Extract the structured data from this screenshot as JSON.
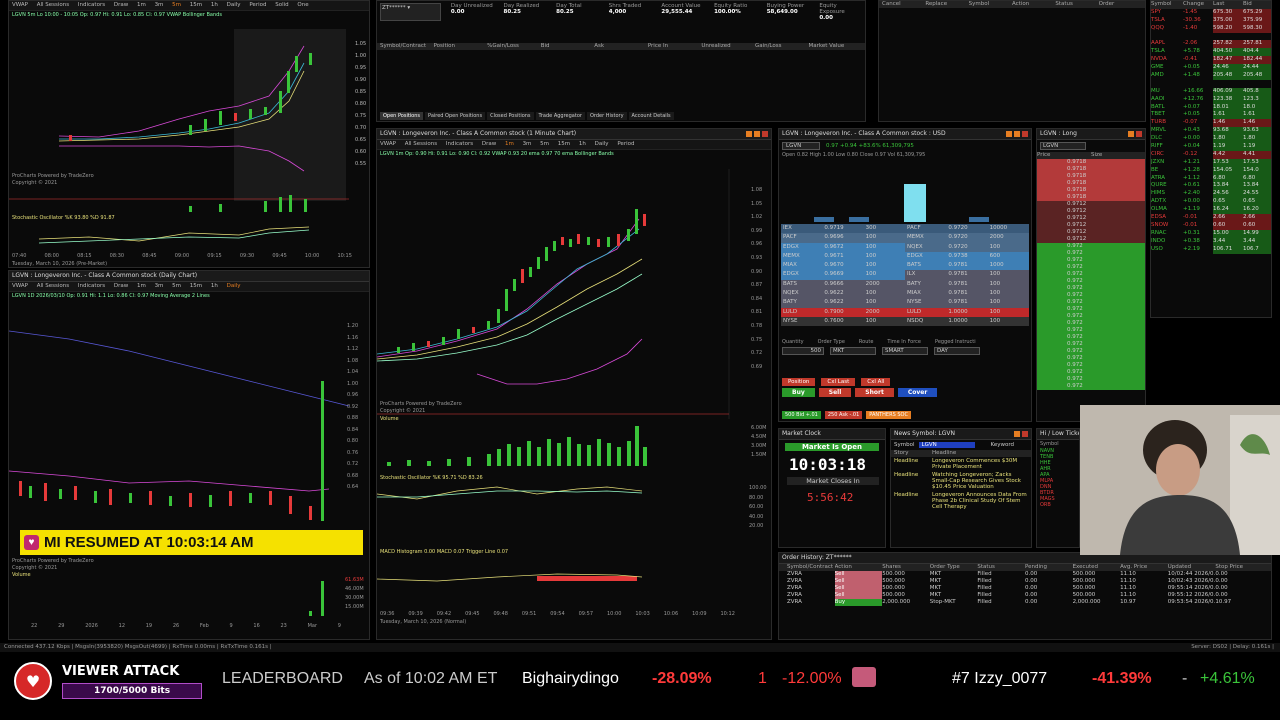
{
  "top_left_chart": {
    "toolbar": [
      "VWAP",
      "All Sessions",
      "Indicators",
      "Draw",
      "1m",
      "3m",
      "5m",
      "15m",
      "1h",
      "Daily",
      "Period",
      "Solid",
      "One"
    ],
    "info": "LGVN 5m  Lo 10:00 - 10:05  Op: 0.97  Hi: 0.91  Lo: 0.85  Cl: 0.97  VWAP  Bollinger Bands",
    "bottom_label": "ProCharts Powered by TradeZero",
    "copyright": "Copyright © 2021",
    "date_label": "Tuesday, March 10, 2026 (Pre-Market)",
    "stoch_label": "Stochastic Oscillator  %K 93.80  %D 91.87",
    "x_ticks": [
      "07:40",
      "08:00",
      "08:15",
      "08:30",
      "08:45",
      "09:00",
      "09:15",
      "09:30",
      "09:45",
      "10:00",
      "10:15"
    ],
    "y_ticks": [
      "1.05",
      "1.00",
      "0.95",
      "0.90",
      "0.85",
      "0.80",
      "0.75",
      "0.70",
      "0.65",
      "0.60",
      "0.55"
    ]
  },
  "daily_chart": {
    "title": "LGVN : Longeveron Inc. - Class A Common stock (Daily Chart)",
    "info": "LGVN 1D  2026/03/10  Op: 0.91  Hi: 1.1  Lo: 0.86  Cl: 0.97  Moving Average 2 Lines",
    "x_ticks": [
      "22",
      "29",
      "2026",
      "12",
      "19",
      "26",
      "Feb",
      "9",
      "16",
      "23",
      "Mar",
      "9"
    ],
    "y_ticks": [
      "1.20",
      "1.16",
      "1.12",
      "1.08",
      "1.04",
      "1.00",
      "0.96",
      "0.92",
      "0.88",
      "0.84",
      "0.80",
      "0.76",
      "0.72",
      "0.68",
      "0.64"
    ],
    "volume_label": "Volume",
    "vol_ticks": [
      "61.63M",
      "46.00M",
      "30.00M",
      "15.00M"
    ]
  },
  "resumed_banner": "MI RESUMED AT 10:03:14 AM",
  "account": {
    "account_id": "ZT******",
    "stats": [
      {
        "label": "Day Unrealized",
        "value": "0.00"
      },
      {
        "label": "Day Realized",
        "value": "80.25"
      },
      {
        "label": "Day Total",
        "value": "80.25"
      },
      {
        "label": "Shrs Traded",
        "value": "4,000"
      },
      {
        "label": "Account Value",
        "value": "29,555.44"
      },
      {
        "label": "Equity Ratio",
        "value": "100.00%"
      },
      {
        "label": "Buying Power",
        "value": "58,649.00"
      },
      {
        "label": "Equity Exposure",
        "value": "0.00"
      }
    ],
    "columns": [
      "Symbol/Contract",
      "Position",
      "%Gain/Loss",
      "Bid",
      "Ask",
      "Price In",
      "Unrealized",
      "Gain/Loss",
      "Market Value"
    ],
    "tabs": [
      "Open Positions",
      "Paired Open Positions",
      "Closed Positions",
      "Trade Aggregator",
      "Order History",
      "Account Details"
    ]
  },
  "orders_header": [
    "Cancel",
    "Replace",
    "Symbol",
    "Action",
    "Status",
    "Order"
  ],
  "main_chart": {
    "title": "LGVN : Longeveron Inc. - Class A Common stock (1 Minute Chart)",
    "info": "LGVN 1m  Op: 0.90  Hi: 0.91  Lo: 0.90  Cl: 0.92  VWAP 0.93  20 ema  0.97  70 ema  Bollinger Bands",
    "x_ticks": [
      "09:36",
      "09:39",
      "09:42",
      "09:45",
      "09:48",
      "09:51",
      "09:54",
      "09:57",
      "10:00",
      "10:03",
      "10:06",
      "10:09",
      "10:12"
    ],
    "y_ticks": [
      "1.08",
      "1.05",
      "1.02",
      "0.99",
      "0.96",
      "0.93",
      "0.90",
      "0.87",
      "0.84",
      "0.81",
      "0.78",
      "0.75",
      "0.72",
      "0.69"
    ],
    "powered": "ProCharts Powered by TradeZero",
    "copyright": "Copyright © 2021",
    "volume_label": "Volume",
    "stoch_label": "Stochastic Oscillator  %K 95.71  %D 83.26",
    "macd_label": "MACD  Histogram 0.00  MACD 0.07  Trigger Line 0.07",
    "date_label": "Tuesday, March 10, 2026 (Normal)",
    "stoch_ticks": [
      "100.00",
      "80.00",
      "60.00",
      "40.00",
      "20.00"
    ],
    "vol_ticks": [
      "6.00M",
      "4.50M",
      "3.00M",
      "1.50M"
    ]
  },
  "level2": {
    "title": "LGVN : Longeveron Inc. - Class A Common stock : USD",
    "symbol": "LGVN",
    "quote": "0.97   +0.94   +83.6%   61,309,795",
    "stats": "Open 0.82  High 1.00  Low 0.80   Close 0.97  Vol 61,309,795",
    "bid_rows": [
      [
        "IEX",
        "0.9719",
        "300"
      ],
      [
        "PACF",
        "0.9696",
        "100"
      ],
      [
        "EDGX",
        "0.9672",
        "100"
      ],
      [
        "MEMX",
        "0.9671",
        "100"
      ],
      [
        "MIAX",
        "0.9670",
        "100"
      ],
      [
        "EDGX",
        "0.9669",
        "100"
      ],
      [
        "BATS",
        "0.9666",
        "2000"
      ],
      [
        "NQEX",
        "0.9622",
        "100"
      ],
      [
        "BATY",
        "0.9622",
        "100"
      ],
      [
        "LULD",
        "0.7900",
        "2000"
      ],
      [
        "NYSE",
        "0.7600",
        "100"
      ]
    ],
    "ask_rows": [
      [
        "PACF",
        "0.9720",
        "10000"
      ],
      [
        "MEMX",
        "0.9720",
        "2000"
      ],
      [
        "NQEX",
        "0.9720",
        "100"
      ],
      [
        "EDGX",
        "0.9738",
        "600"
      ],
      [
        "BATS",
        "0.9781",
        "1000"
      ],
      [
        "ILX",
        "0.9781",
        "100"
      ],
      [
        "BATY",
        "0.9781",
        "100"
      ],
      [
        "MIAX",
        "0.9781",
        "100"
      ],
      [
        "NYSE",
        "0.9781",
        "100"
      ],
      [
        "LULD",
        "1.0000",
        "100"
      ],
      [
        "NSDQ",
        "1.0000",
        "100"
      ]
    ],
    "order_fields": [
      "Quantity",
      "Order Type",
      "Route",
      "Time In Force",
      "Pegged Instructi"
    ],
    "qty": "500",
    "order_type": "MKT",
    "route": "SMART",
    "tif": "DAY",
    "buttons": [
      "Position",
      "Cxl Last",
      "Cxl All",
      "Buy",
      "Sell",
      "Short",
      "Cover"
    ],
    "quick": [
      "500 Bid +.01",
      "250 Ask -.01",
      "PANTHERS SOC"
    ]
  },
  "time_sales": {
    "title": "LGVN : Long",
    "symbol": "LGVN",
    "cols": [
      "Price",
      "Size"
    ],
    "prices": [
      "0.9718",
      "0.9718",
      "0.9718",
      "0.9718",
      "0.9718",
      "0.9718",
      "0.9712",
      "0.9712",
      "0.9712",
      "0.9712",
      "0.9712",
      "0.9712",
      "0.972",
      "0.972",
      "0.972",
      "0.972",
      "0.972",
      "0.972",
      "0.972",
      "0.972",
      "0.972",
      "0.972",
      "0.972",
      "0.972",
      "0.972",
      "0.972",
      "0.972",
      "0.972",
      "0.972",
      "0.972",
      "0.972",
      "0.972",
      "0.972"
    ]
  },
  "market_clock": {
    "title": "Market Clock",
    "status": "Market Is Open",
    "time": "10:03:18",
    "closes_label": "Market Closes In",
    "countdown": "5:56:42"
  },
  "news": {
    "title": "News Symbol: LGVN",
    "symbol_label": "Symbol",
    "symbol": "LGVN",
    "keyword_label": "Keyword",
    "cols": [
      "Story",
      "Headline"
    ],
    "items": [
      {
        "tag": "Headline",
        "text": "Longeveron Commences $30M Private Placement"
      },
      {
        "tag": "Headline",
        "text": "Watching Longeveron; Zacks Small-Cap Research Gives Stock $10.45 Price Valuation"
      },
      {
        "tag": "Headline",
        "text": "Longeveron Announces Data From Phase 2b Clinical Study Of Stem Cell Therapy"
      }
    ]
  },
  "hilo": {
    "title": "Hi / Low Ticker",
    "col": "Symbol",
    "items": [
      "NAVN",
      "TENB",
      "HHE",
      "AHR",
      "APA",
      "MLPA",
      "DNN",
      "BTDR",
      "MAGS",
      "ORB"
    ]
  },
  "order_history": {
    "title": "Order History: ZT******",
    "cols": [
      "Symbol/Contract",
      "Action",
      "Shares",
      "Order Type",
      "Status",
      "Pending",
      "Executed",
      "Avg. Price",
      "Updated",
      "Stop Price"
    ],
    "rows": [
      [
        "ZVRA",
        "Sell",
        "500.000",
        "MKT",
        "Filled",
        "0.00",
        "500.000",
        "11.10",
        "10/02:44 2026/0...",
        "0.00"
      ],
      [
        "ZVRA",
        "Sell",
        "500.000",
        "MKT",
        "Filled",
        "0.00",
        "500.000",
        "11.10",
        "10/02:43 2026/0...",
        "0.00"
      ],
      [
        "ZVRA",
        "Sell",
        "500.000",
        "MKT",
        "Filled",
        "0.00",
        "500.000",
        "11.10",
        "09:55:14 2026/0...",
        "0.00"
      ],
      [
        "ZVRA",
        "Sell",
        "500.000",
        "MKT",
        "Filled",
        "0.00",
        "500.000",
        "11.10",
        "09:55:12 2026/0...",
        "0.00"
      ],
      [
        "ZVRA",
        "Buy",
        "2,000.000",
        "Stop-MKT",
        "Filled",
        "0.00",
        "2,000.000",
        "10.97",
        "09:53:54 2026/0...",
        "10.97"
      ]
    ]
  },
  "watchlist": {
    "cols": [
      "Symbol",
      "Change",
      "Last",
      "Bid"
    ],
    "rows": [
      [
        "SPY",
        "-1.45",
        "675.30",
        "675.29",
        "neg"
      ],
      [
        "TSLA",
        "-30.36",
        "375.00",
        "375.99",
        "neg"
      ],
      [
        "QQQ",
        "-1.40",
        "598.20",
        "598.30",
        "neg"
      ],
      [
        "",
        "",
        "",
        "",
        "blank"
      ],
      [
        "AAPL",
        "-2.06",
        "257.82",
        "257.81",
        "neg"
      ],
      [
        "TSLA",
        "+5.78",
        "404.50",
        "404.4",
        "pos"
      ],
      [
        "NVDA",
        "-0.41",
        "182.47",
        "182.44",
        "neg"
      ],
      [
        "GME",
        "+0.05",
        "24.46",
        "24.44",
        "pos"
      ],
      [
        "AMD",
        "+1.48",
        "205.48",
        "205.48",
        "pos"
      ],
      [
        "",
        "",
        "",
        "",
        "blank"
      ],
      [
        "MU",
        "+16.66",
        "406.09",
        "405.8",
        "pos"
      ],
      [
        "AAOI",
        "+12.76",
        "123.38",
        "123.3",
        "pos"
      ],
      [
        "BATL",
        "+0.07",
        "18.01",
        "18.0",
        "pos"
      ],
      [
        "TBET",
        "+0.05",
        "1.61",
        "1.61",
        "pos"
      ],
      [
        "TURB",
        "-0.07",
        "1.46",
        "1.46",
        "neg"
      ],
      [
        "MRVL",
        "+0.43",
        "93.68",
        "93.63",
        "pos"
      ],
      [
        "DLC",
        "+0.00",
        "1.80",
        "1.80",
        "pos"
      ],
      [
        "RIFF",
        "+0.04",
        "1.19",
        "1.19",
        "pos"
      ],
      [
        "CIRC",
        "-0.12",
        "4.42",
        "4.41",
        "neg"
      ],
      [
        "JZXN",
        "+1.21",
        "17.53",
        "17.53",
        "pos"
      ],
      [
        "BE",
        "+1.28",
        "154.05",
        "154.0",
        "pos"
      ],
      [
        "ATRA",
        "+1.12",
        "6.80",
        "6.80",
        "pos"
      ],
      [
        "QURE",
        "+0.61",
        "13.84",
        "13.84",
        "pos"
      ],
      [
        "HIMS",
        "+2.40",
        "24.56",
        "24.55",
        "pos"
      ],
      [
        "ADTX",
        "+0.00",
        "0.65",
        "0.65",
        "pos"
      ],
      [
        "OLMA",
        "+1.19",
        "16.24",
        "16.20",
        "pos"
      ],
      [
        "EDSA",
        "-0.01",
        "2.66",
        "2.66",
        "neg"
      ],
      [
        "SNOW",
        "-0.01",
        "0.60",
        "0.60",
        "neg"
      ],
      [
        "RNAC",
        "+0.31",
        "15.00",
        "14.99",
        "pos"
      ],
      [
        "INDO",
        "+0.38",
        "3.44",
        "3.44",
        "pos"
      ],
      [
        "USO",
        "+2.19",
        "106.71",
        "106.7",
        "pos"
      ]
    ]
  },
  "status_bar": "Connected 437.12 Kbps | MsgsIn(3953820) MsgsOut(4699) | RxTime 0.00ms | RxTxTime 0.161s |",
  "server": "Server: DS02 | Delay: 0.161s |",
  "viewer_attack": {
    "label": "VIEWER ATTACK",
    "progress": "1700/5000 Bits"
  },
  "leaderboard": {
    "label": "LEADERBOARD",
    "as_of": "As of 10:02 AM ET",
    "entries": [
      {
        "name": "Bighairydingo",
        "pct": "-28.09%",
        "rank": "1",
        "chg": "-12.00%"
      },
      {
        "name": "#7 Izzy_0077",
        "pct": "-41.39%",
        "rank": "-",
        "chg": "+4.61%"
      }
    ]
  }
}
